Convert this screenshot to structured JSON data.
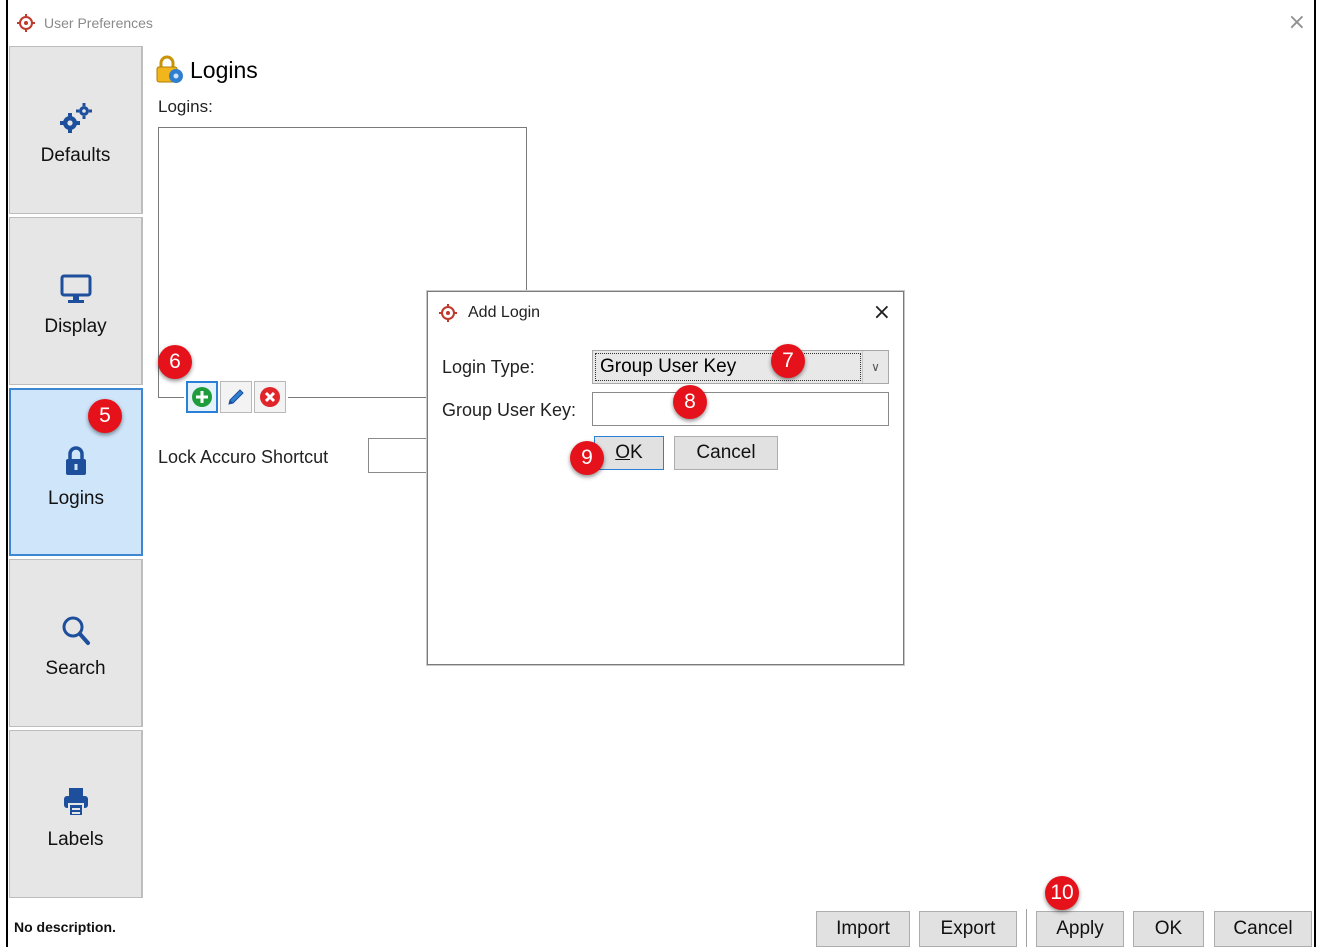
{
  "window": {
    "title": "User Preferences",
    "close_glyph": "×",
    "app_icon": "accuro-target-icon"
  },
  "sidebar": {
    "items": [
      {
        "label": "Defaults",
        "icon": "gears-icon",
        "active": false
      },
      {
        "label": "Display",
        "icon": "monitor-icon",
        "active": false
      },
      {
        "label": "Logins",
        "icon": "lock-icon",
        "active": true
      },
      {
        "label": "Search",
        "icon": "magnifier-icon",
        "active": false
      },
      {
        "label": "Labels",
        "icon": "printer-icon",
        "active": false
      }
    ]
  },
  "main": {
    "section_title": "Logins",
    "logins_label": "Logins:",
    "toolbar": {
      "add": "add-icon",
      "edit": "pencil-icon",
      "remove": "remove-icon"
    },
    "lock_shortcut_label": "Lock Accuro Shortcut",
    "lock_shortcut_value": ""
  },
  "dialog": {
    "title": "Add Login",
    "close_glyph": "×",
    "login_type_label": "Login Type:",
    "login_type_value": "Group User Key",
    "group_user_key_label": "Group User Key:",
    "group_user_key_value": "",
    "ok_label_u": "O",
    "ok_label_rest": "K",
    "cancel_label": "Cancel"
  },
  "footer": {
    "status": "No description.",
    "buttons": {
      "import": "Import",
      "export": "Export",
      "apply": "Apply",
      "ok": "OK",
      "cancel": "Cancel"
    }
  },
  "annotations": {
    "b5": "5",
    "b6": "6",
    "b7": "7",
    "b8": "8",
    "b9": "9",
    "b10": "10"
  },
  "colors": {
    "badge": "#e5121b",
    "active_tab": "#cfe5fa",
    "focus": "#2a7fd6"
  }
}
